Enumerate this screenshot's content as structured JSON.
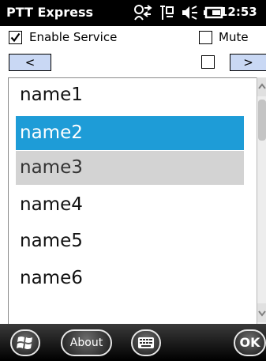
{
  "status_bar": {
    "app_title": "PTT Express",
    "clock": "12:53",
    "icons": [
      "connectivity-icon",
      "signal-icon",
      "volume-icon",
      "battery-icon"
    ]
  },
  "options": {
    "enable_service": {
      "label": "Enable Service",
      "checked": true
    },
    "mute": {
      "label": "Mute",
      "checked": false
    },
    "secondary_checkbox": {
      "checked": false
    }
  },
  "nav": {
    "prev_label": "<",
    "next_label": ">"
  },
  "list": {
    "items": [
      "name1",
      "name2",
      "name3",
      "name4",
      "name5",
      "name6"
    ],
    "selected_index": 1,
    "highlighted_index": 2
  },
  "soft_keys": {
    "start_icon": "windows-logo-icon",
    "about_label": "About",
    "keyboard_icon": "keyboard-icon",
    "ok_label": "OK"
  },
  "colors": {
    "selection": "#1e9cd7",
    "highlight": "#d3d3d3",
    "nav_button": "#c9d8f4"
  }
}
